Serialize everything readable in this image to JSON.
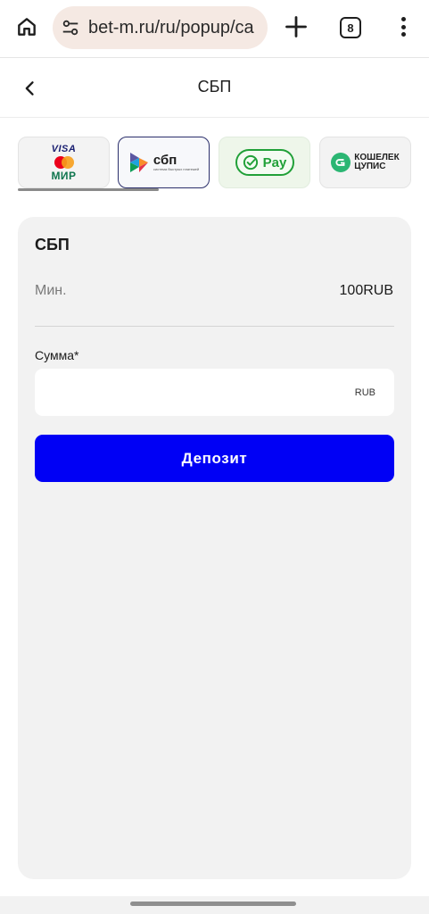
{
  "browser": {
    "url": "bet-m.ru/ru/popup/ca",
    "tab_count": "8",
    "icons": {
      "home": "home-icon",
      "site_settings": "tune-icon",
      "new_tab": "plus-icon",
      "tabs": "tab-switcher-icon",
      "menu": "more-vert-icon"
    }
  },
  "header": {
    "back_icon": "chevron-left-icon",
    "title": "СБП"
  },
  "methods": [
    {
      "id": "cards",
      "lines": [
        "VISA",
        "МИР"
      ],
      "selected": false
    },
    {
      "id": "sbp",
      "big": "сбп",
      "small": "система быстрых платежей",
      "selected": true
    },
    {
      "id": "sberpay",
      "label": "Pay",
      "selected": false
    },
    {
      "id": "wallet",
      "lines": [
        "КОШЕЛЕК",
        "ЦУПИС"
      ],
      "selected": false
    }
  ],
  "deposit": {
    "title": "СБП",
    "min_label": "Мин.",
    "min_value": "100RUB",
    "amount_label": "Сумма*",
    "amount_value": "",
    "currency": "RUB",
    "submit_label": "Депозит"
  },
  "colors": {
    "accent": "#0000f5",
    "card_bg": "#f2f2f2",
    "sber_green": "#21a038",
    "url_pill": "#f5e9e3"
  }
}
